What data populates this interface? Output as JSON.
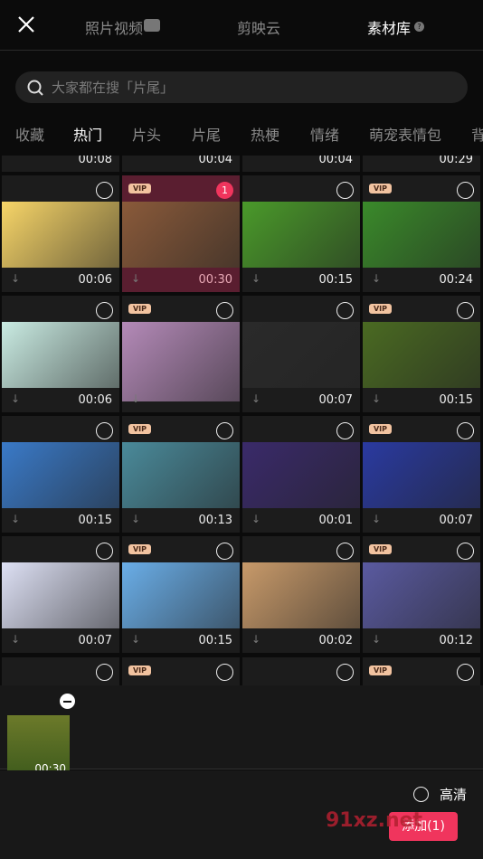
{
  "header": {
    "tabs": [
      {
        "label": "照片视频"
      },
      {
        "label": "剪映云"
      },
      {
        "label": "素材库"
      }
    ],
    "active": "素材库"
  },
  "search": {
    "placeholder": "大家都在搜「片尾」"
  },
  "categories": [
    "收藏",
    "热门",
    "片头",
    "片尾",
    "热梗",
    "情绪",
    "萌宠表情包",
    "背"
  ],
  "active_category": "热门",
  "grid": {
    "partial_top": [
      "00:08",
      "00:04",
      "00:04",
      "00:29"
    ],
    "rows": [
      [
        {
          "d": "00:06",
          "vip": false,
          "c": "#f7d568"
        },
        {
          "d": "00:30",
          "vip": true,
          "sel": "1",
          "c": "#8a5a3a"
        },
        {
          "d": "00:15",
          "vip": false,
          "c": "#4a9a2a"
        },
        {
          "d": "00:24",
          "vip": true,
          "c": "#3a8a2a"
        }
      ],
      [
        {
          "d": "00:06",
          "vip": false,
          "c": "#c9ebe2"
        },
        {
          "d": "",
          "vip": true,
          "c": "#b48ab8"
        },
        {
          "d": "00:07",
          "vip": false,
          "c": "#2a2a2a"
        },
        {
          "d": "00:15",
          "vip": true,
          "c": "#4a6a22"
        }
      ],
      [
        {
          "d": "00:15",
          "vip": false,
          "c": "#3a7ac8"
        },
        {
          "d": "00:13",
          "vip": true,
          "c": "#4a8a9a"
        },
        {
          "d": "00:01",
          "vip": false,
          "c": "#3a2a6a"
        },
        {
          "d": "00:07",
          "vip": true,
          "c": "#2a3aa0"
        }
      ],
      [
        {
          "d": "00:07",
          "vip": false,
          "c": "#dde0f4"
        },
        {
          "d": "00:15",
          "vip": true,
          "c": "#6aaee8"
        },
        {
          "d": "00:02",
          "vip": false,
          "c": "#c89a6a"
        },
        {
          "d": "00:12",
          "vip": true,
          "c": "#5a5aa0"
        }
      ]
    ],
    "partial_bottom_vip": [
      false,
      true,
      false,
      true
    ]
  },
  "selected": {
    "duration": "00:30"
  },
  "footer": {
    "hd_label": "高清",
    "add_label": "添加(1)"
  },
  "watermark": "91xz.net",
  "colors": {
    "accent": "#f0355d",
    "vip": "#f2c3a0"
  }
}
